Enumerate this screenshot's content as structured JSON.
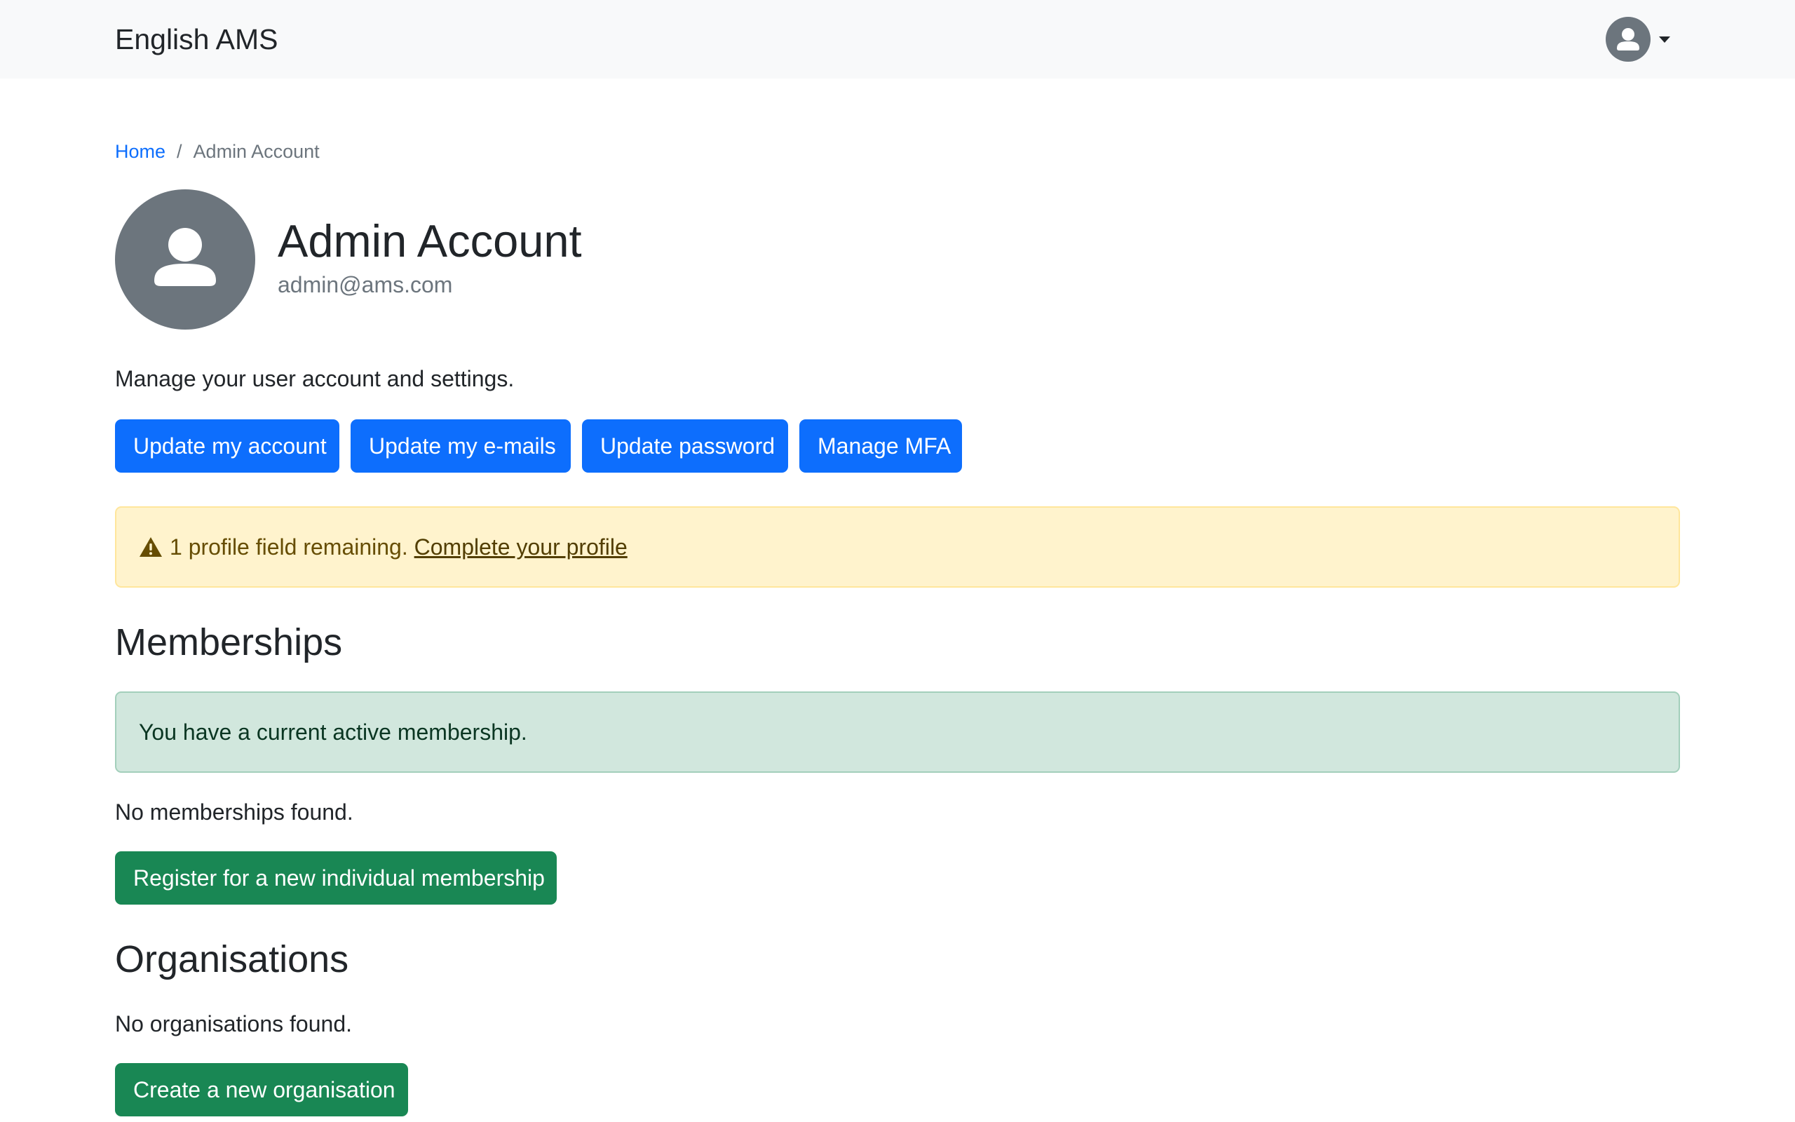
{
  "navbar": {
    "brand": "English AMS",
    "user_menu": {
      "icon": "user-icon",
      "dropdown_icon": "caret-down-icon"
    }
  },
  "breadcrumb": {
    "home": "Home",
    "separator": "/",
    "current": "Admin Account"
  },
  "profile": {
    "avatar_icon": "user-icon",
    "name": "Admin Account",
    "email": "admin@ams.com"
  },
  "intro": "Manage your user account and settings.",
  "account_actions": [
    {
      "label": "Update my account"
    },
    {
      "label": "Update my e-mails"
    },
    {
      "label": "Update password"
    },
    {
      "label": "Manage MFA"
    }
  ],
  "profile_alert": {
    "icon": "warning-triangle-icon",
    "text": "1 profile field remaining.",
    "link": "Complete your profile"
  },
  "memberships": {
    "title": "Memberships",
    "status_alert": "You have a current active membership.",
    "empty_text": "No memberships found.",
    "register_button": "Register for a new individual membership"
  },
  "organisations": {
    "title": "Organisations",
    "empty_text": "No organisations found.",
    "create_button": "Create a new organisation"
  },
  "colors": {
    "primary": "#0d6efd",
    "success": "#198754",
    "warning_bg": "#fff3cd",
    "success_bg": "#d1e7dd",
    "avatar_gray": "#6c757d"
  }
}
